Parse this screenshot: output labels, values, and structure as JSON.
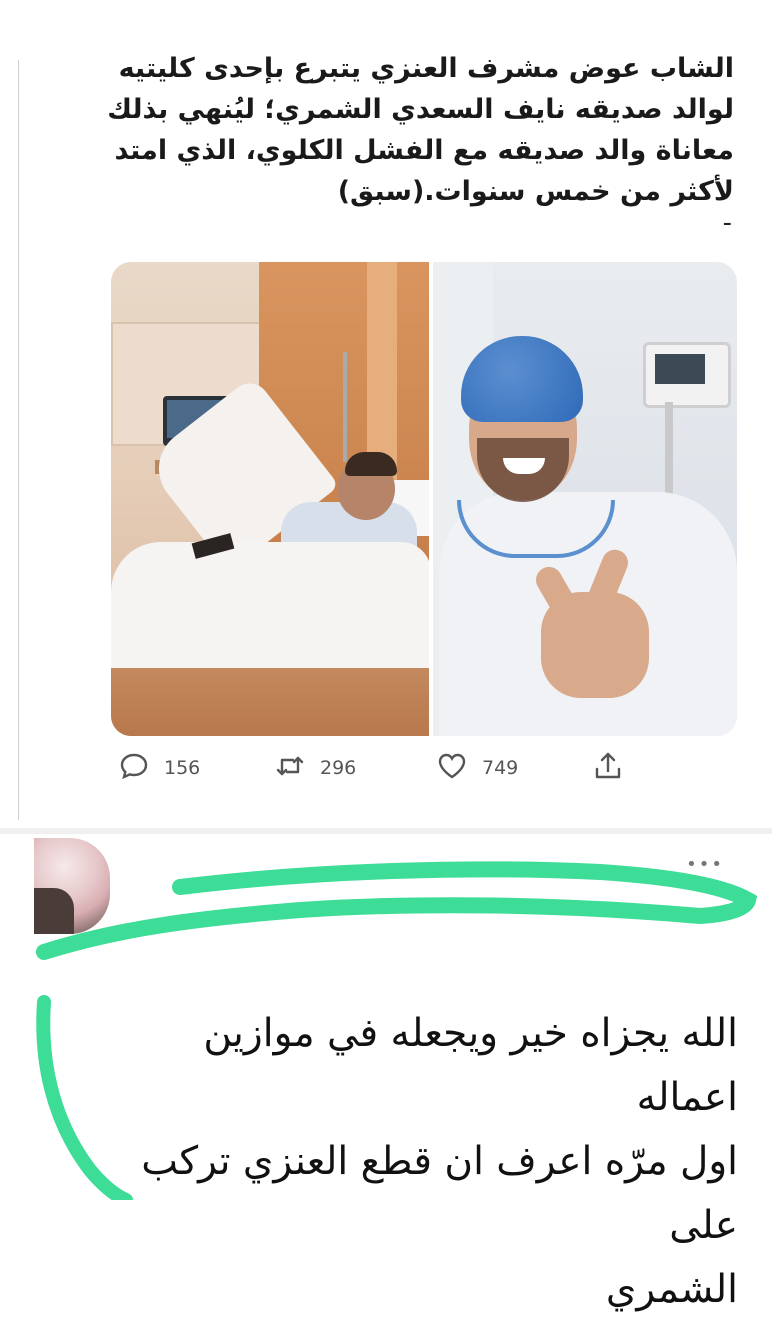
{
  "tweet": {
    "text": "الشاب عوض مشرف العنزي يتبرع بإحدى كليتيه لوالد صديقه نايف السعدي الشمري؛ ليُنهي بذلك معاناة والد صديقه مع الفشل الكلوي، الذي امتد لأكثر من خمس سنوات.(سبق)",
    "trailing_mark": "-",
    "actions": {
      "replies": "156",
      "retweets": "296",
      "likes": "749"
    }
  },
  "comment": {
    "line1": "الله يجزاه خير ويجعله في موازين اعماله",
    "line2": "اول مرّه اعرف ان قطع العنزي تركب على",
    "line3": "الشمري",
    "more": "•••"
  },
  "colors": {
    "highlighter": "#3ddc97",
    "icon_gray": "#555555"
  },
  "icons": {
    "reply": "reply-icon",
    "retweet": "retweet-icon",
    "like": "heart-icon",
    "share": "share-icon"
  }
}
